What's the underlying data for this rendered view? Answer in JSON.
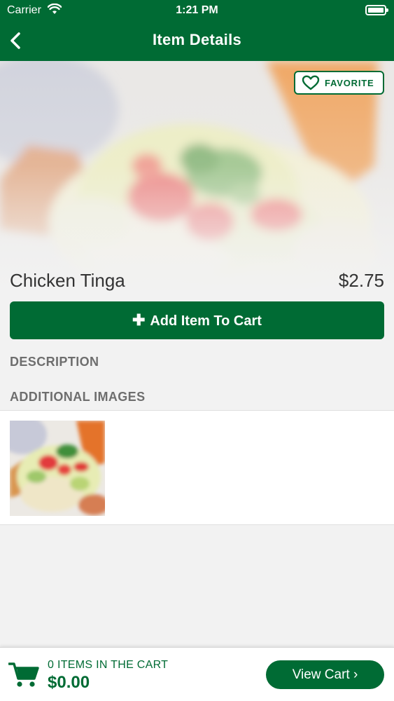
{
  "status_bar": {
    "carrier": "Carrier",
    "time": "1:21 PM"
  },
  "nav": {
    "title": "Item Details",
    "back_icon": "chevron-left-icon"
  },
  "hero": {
    "favorite_label": "FAVORITE",
    "favorite_icon": "heart-outline-icon"
  },
  "item": {
    "name": "Chicken Tinga",
    "price": "$2.75"
  },
  "actions": {
    "add_to_cart_label": "Add Item To Cart",
    "add_icon": "plus-icon"
  },
  "sections": {
    "description": "DESCRIPTION",
    "additional_images": "ADDITIONAL IMAGES"
  },
  "cart": {
    "count_label": "0 ITEMS IN THE CART",
    "total": "$0.00",
    "view_cart_label": "View Cart",
    "cart_icon": "shopping-cart-icon"
  },
  "colors": {
    "brand_green": "#006b34",
    "background": "#f2f2f2"
  }
}
